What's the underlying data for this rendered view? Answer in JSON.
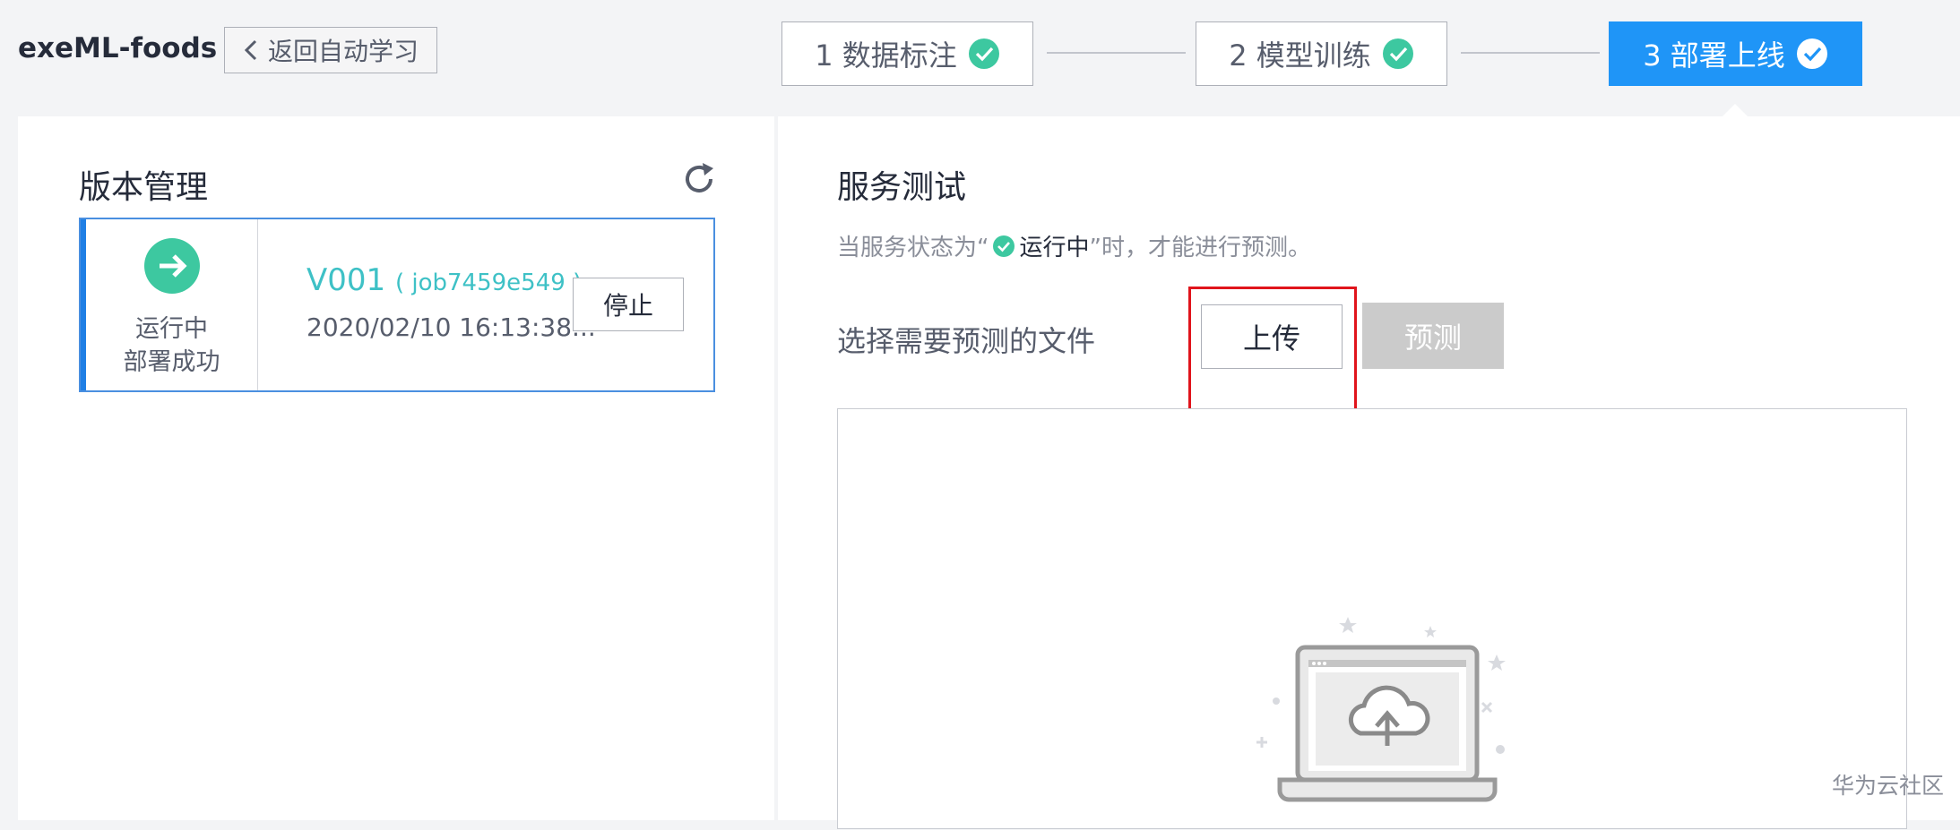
{
  "header": {
    "app_title": "exeML-foods",
    "back_label": "返回自动学习",
    "steps": [
      {
        "label": "1 数据标注",
        "status": "done"
      },
      {
        "label": "2 模型训练",
        "status": "done"
      },
      {
        "label": "3 部署上线",
        "status": "active"
      }
    ]
  },
  "version_panel": {
    "title": "版本管理",
    "card": {
      "status_line1": "运行中",
      "status_line2": "部署成功",
      "version": "V001",
      "job": "( job7459e549 )",
      "time": "2020/02/10 16:13:38...",
      "stop_label": "停止"
    }
  },
  "service_panel": {
    "title": "服务测试",
    "hint_prefix": "当服务状态为“",
    "hint_status": "运行中",
    "hint_suffix": "”时，才能进行预测。",
    "file_label": "选择需要预测的文件",
    "upload_label": "上传",
    "predict_label": "预测"
  },
  "watermark": "华为云社区",
  "colors": {
    "accent": "#1f95f7",
    "success": "#3dc8a0",
    "link": "#3ec1c6",
    "highlight": "#e0141c"
  }
}
